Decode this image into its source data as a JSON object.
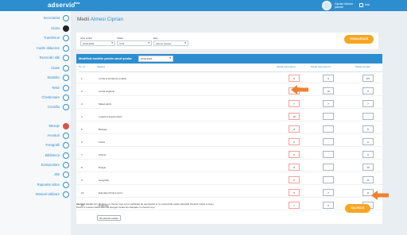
{
  "header": {
    "logo": "adservio",
    "logo_sub": "Beta",
    "user_name": "Ciprian Almesi",
    "user_role": "parinte",
    "logout_label": "Ieși"
  },
  "sidebar": {
    "items": [
      {
        "label": "Secretariat",
        "icon": "briefcase-icon"
      },
      {
        "label": "Clasa",
        "icon": "user-icon",
        "active": true
      },
      {
        "label": "Transferuri",
        "icon": "transfer-icon"
      },
      {
        "label": "Cadre didactice",
        "icon": "teacher-icon"
      },
      {
        "label": "Rezervări săli",
        "icon": "calendar-icon"
      },
      {
        "label": "Clase",
        "icon": "class-icon"
      },
      {
        "label": "Statistici",
        "icon": "chart-icon"
      },
      {
        "label": "Teste",
        "icon": "test-icon"
      },
      {
        "label": "Chestionare",
        "icon": "question-icon"
      },
      {
        "label": "Consiliu",
        "icon": "group-icon"
      },
      {
        "label": "Mesaje",
        "icon": "mail-icon",
        "red": true
      },
      {
        "label": "Anunțuri",
        "icon": "megaphone-icon"
      },
      {
        "label": "Fotografii",
        "icon": "camera-icon"
      },
      {
        "label": "Biblioteca",
        "icon": "book-icon"
      },
      {
        "label": "Extrașcolare",
        "icon": "star-icon"
      },
      {
        "label": "Jitsi",
        "icon": "video-icon"
      },
      {
        "label": "Rapoarte video",
        "icon": "report-icon"
      },
      {
        "label": "Manual Utilizare",
        "icon": "help-icon"
      }
    ]
  },
  "page": {
    "title_prefix": "Medii",
    "title_name": "Almesi Ciprian"
  },
  "filters": {
    "labels": [
      "Anul școlar",
      "Clasa",
      "Elev"
    ],
    "values": [
      "2019-2020",
      "XI-B",
      "Almesi Ciprian"
    ],
    "show_button": "VIZUALIZEAZĂ"
  },
  "grid": {
    "title": "Modifică mediile pentru anul școlar",
    "year_value": "2019-2020",
    "columns": [
      "Nr. crt.",
      "Materia",
      "Media Semestrul I",
      "Media Semestrul II",
      "Media anuală"
    ],
    "rows": [
      {
        "nr": "1.",
        "subject": "Limba și literatura română",
        "s1": "8",
        "s2": "9",
        "annual": "8.5"
      },
      {
        "nr": "2.",
        "subject": "Limba engleză",
        "s1": "9",
        "s2": "10",
        "annual": "9"
      },
      {
        "nr": "3.",
        "subject": "Matematică",
        "s1": "7",
        "s2": "7",
        "annual": "7"
      },
      {
        "nr": "4.",
        "subject": "Logică și argumentare",
        "s1": "10",
        "s2": "",
        "annual": ""
      },
      {
        "nr": "5.",
        "subject": "Biologie",
        "s1": "8",
        "s2": "",
        "annual": "8"
      },
      {
        "nr": "6.",
        "subject": "Fizică",
        "s1": "6",
        "s2": "",
        "annual": "6"
      },
      {
        "nr": "7.",
        "subject": "Chimie",
        "s1": "9",
        "s2": "",
        "annual": "9"
      },
      {
        "nr": "8.",
        "subject": "Religie",
        "s1": "8",
        "s2": "",
        "annual": "10"
      },
      {
        "nr": "9.",
        "subject": "Geografie",
        "s1": "8",
        "s2": "",
        "annual": "8"
      },
      {
        "nr": "10.",
        "subject": "Educație fizică și sport",
        "s1": "6",
        "s2": "7",
        "annual": "8"
      },
      {
        "nr": "11.",
        "subject": "Dirigenție",
        "s1": "7",
        "s2": "6",
        "annual": "6"
      }
    ],
    "restore_button": "Recalculă mediile"
  },
  "footer": {
    "note_bold": "Atenție!",
    "note_line1": "Mediile din căsuțele cu chenar roșu sunt modificate de secretariat și nu reprezintă media calculată folosind notele și tezei.",
    "note_line2": "Pentru a reseta media automat ștergeți media din căsuțele cu chenar roșu.",
    "save_button": "SALVEAZĂ"
  },
  "colors": {
    "topbar": "#2d8ecf",
    "accent": "#f5a623",
    "arrow": "#f08030"
  }
}
